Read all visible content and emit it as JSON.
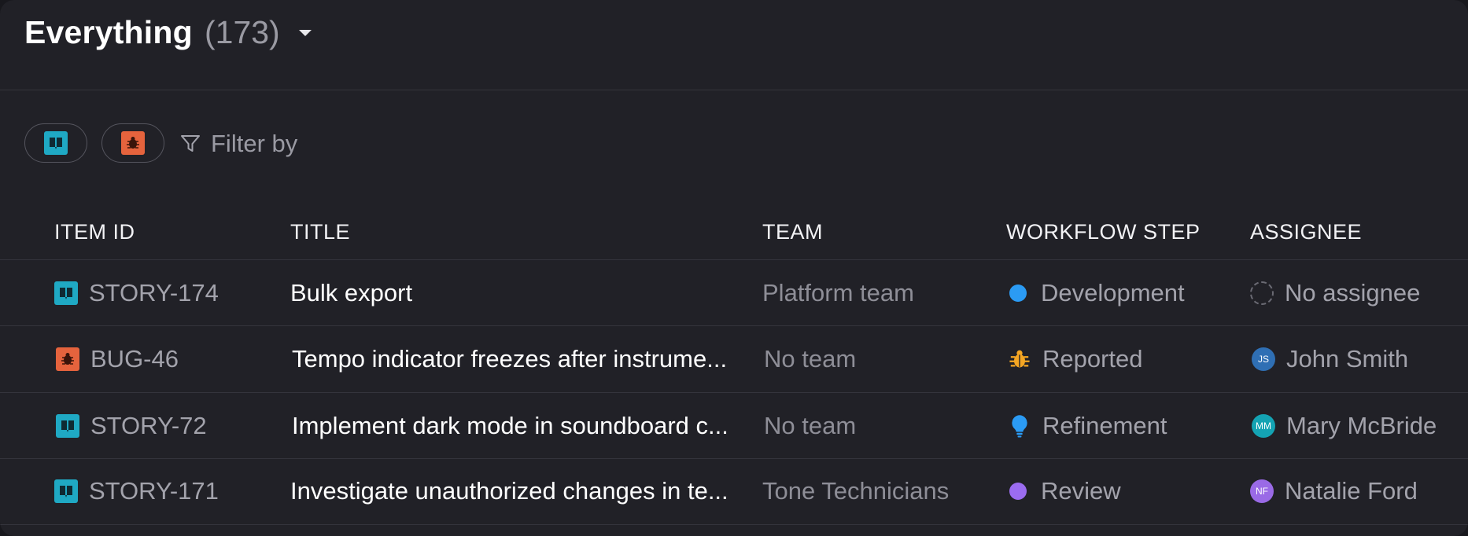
{
  "header": {
    "title": "Everything",
    "count": "(173)"
  },
  "filters": {
    "chips": [
      "story-type-chip",
      "bug-type-chip"
    ],
    "filter_label": "Filter by"
  },
  "columns": {
    "id": "ITEM ID",
    "title": "TITLE",
    "team": "TEAM",
    "step": "WORKFLOW STEP",
    "assignee": "ASSIGNEE"
  },
  "rows": [
    {
      "id": "STORY-174",
      "type_icon": "story-icon",
      "title": "Bulk export",
      "team": "Platform team",
      "step": "Development",
      "step_icon": "dot",
      "step_color": "#2b9bf4",
      "assignee": "No assignee",
      "initials": "",
      "avatar_color": ""
    },
    {
      "id": "BUG-46",
      "type_icon": "bug-icon",
      "title": "Tempo indicator freezes after instrume...",
      "team": "No team",
      "step": "Reported",
      "step_icon": "bug-icon",
      "step_color": "#f5a623",
      "assignee": "John Smith",
      "initials": "JS",
      "avatar_color": "#2f6fb4"
    },
    {
      "id": "STORY-72",
      "type_icon": "story-icon",
      "title": "Implement dark mode in soundboard c...",
      "team": "No team",
      "step": "Refinement",
      "step_icon": "lightbulb-icon",
      "step_color": "#2b9bf4",
      "assignee": "Mary McBride",
      "initials": "MM",
      "avatar_color": "#14a3b3"
    },
    {
      "id": "STORY-171",
      "type_icon": "story-icon",
      "title": "Investigate unauthorized changes in te...",
      "team": "Tone Technicians",
      "step": "Review",
      "step_icon": "dot",
      "step_color": "#9b6cf0",
      "assignee": "Natalie Ford",
      "initials": "NF",
      "avatar_color": "#9a6ae6"
    }
  ]
}
